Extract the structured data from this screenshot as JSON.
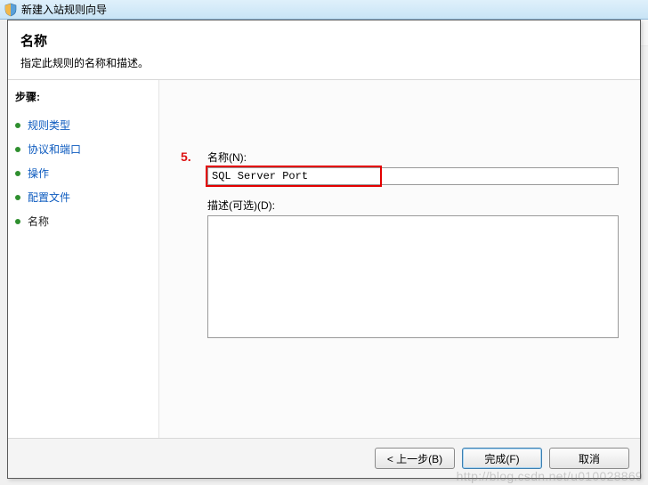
{
  "bg_window": {
    "title": "新建入站规则向导"
  },
  "wizard": {
    "header": {
      "title": "名称",
      "subtitle": "指定此规则的名称和描述。"
    },
    "sidebar": {
      "steps_label": "步骤:",
      "items": [
        {
          "label": "规则类型",
          "state": "done"
        },
        {
          "label": "协议和端口",
          "state": "done"
        },
        {
          "label": "操作",
          "state": "done"
        },
        {
          "label": "配置文件",
          "state": "done"
        },
        {
          "label": "名称",
          "state": "current"
        }
      ]
    },
    "main": {
      "annotation": "5.",
      "name_label": "名称(N):",
      "name_value": "SQL Server Port",
      "desc_label": "描述(可选)(D):",
      "desc_value": ""
    },
    "footer": {
      "back": "< 上一步(B)",
      "finish": "完成(F)",
      "cancel": "取消"
    }
  },
  "watermark": "http://blog.csdn.net/u010028869"
}
